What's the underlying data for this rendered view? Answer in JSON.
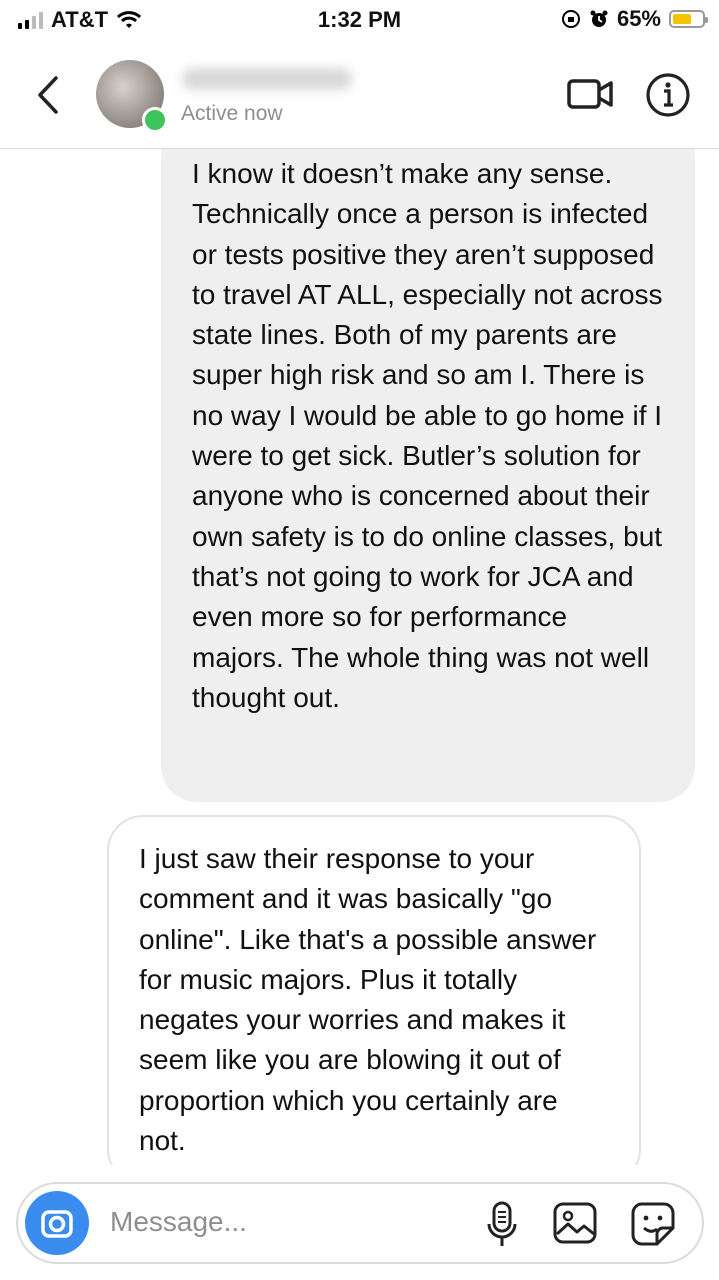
{
  "status_bar": {
    "carrier": "AT&T",
    "time": "1:32 PM",
    "battery": "65%",
    "battery_level": 0.65
  },
  "header": {
    "status": "Active now",
    "icons": [
      "back-chevron-icon",
      "avatar",
      "video-camera-icon",
      "info-icon"
    ]
  },
  "messages": [
    {
      "direction": "received",
      "text": "I know it doesn’t make any sense. Technically once a person is infected or tests positive they aren’t supposed to travel AT ALL, especially not across state lines. Both of my parents are super high risk and so am I. There is no way I would be able to go home if I were to get sick. Butler’s solution for anyone who is concerned about their own safety is to do online classes, but that’s not going to work for JCA and even more so for performance majors. The whole thing was not well thought out."
    },
    {
      "direction": "sent",
      "text": "I just saw their response to your comment and it was basically \"go online\". Like that's a possible answer for music majors. Plus it totally negates your worries and makes it seem like you are blowing it out of proportion which you certainly are not."
    }
  ],
  "composer": {
    "placeholder": "Message...",
    "icons": [
      "camera-icon",
      "microphone-icon",
      "gallery-icon",
      "sticker-icon"
    ]
  },
  "colors": {
    "received_bubble": "#efefef",
    "online_dot": "#3ec35d",
    "camera_button": "#3a8dee",
    "battery_fill": "#f5c400"
  }
}
